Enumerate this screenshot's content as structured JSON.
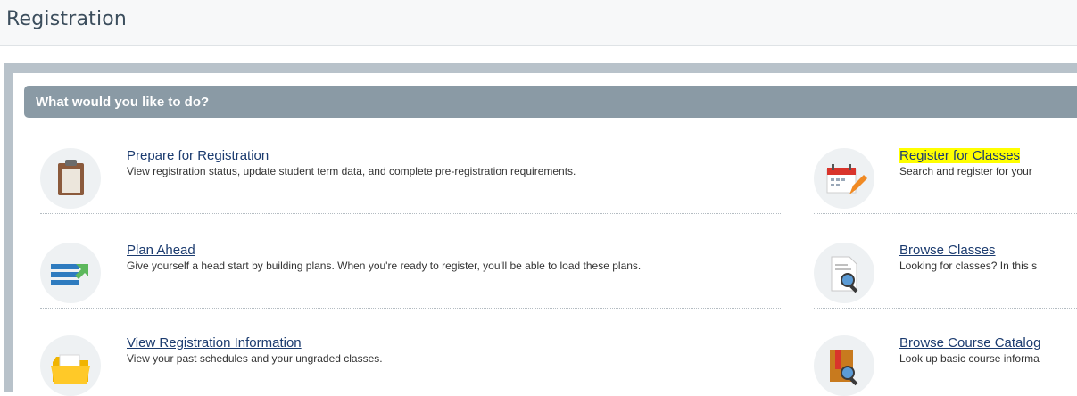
{
  "page": {
    "title": "Registration"
  },
  "section": {
    "title": "What would you like to do?"
  },
  "left_items": [
    {
      "label": "Prepare for Registration",
      "description": "View registration status, update student term data, and complete pre-registration requirements.",
      "icon": "clipboard-icon"
    },
    {
      "label": "Plan Ahead",
      "description": "Give yourself a head start by building plans. When you're ready to register, you'll be able to load these plans.",
      "icon": "plan-list-icon"
    },
    {
      "label": "View Registration Information",
      "description": "View your past schedules and your ungraded classes.",
      "icon": "folder-icon"
    }
  ],
  "right_items": [
    {
      "label": "Register for Classes",
      "description": "Search and register for your",
      "icon": "calendar-edit-icon",
      "highlighted": true
    },
    {
      "label": "Browse Classes",
      "description": "Looking for classes? In this s",
      "icon": "document-search-icon"
    },
    {
      "label": "Browse Course Catalog",
      "description": "Look up basic course informa",
      "icon": "book-search-icon"
    }
  ],
  "colors": {
    "link": "#1b3b6f",
    "header_bar": "#8a9aa5",
    "highlight": "#ffff00"
  }
}
